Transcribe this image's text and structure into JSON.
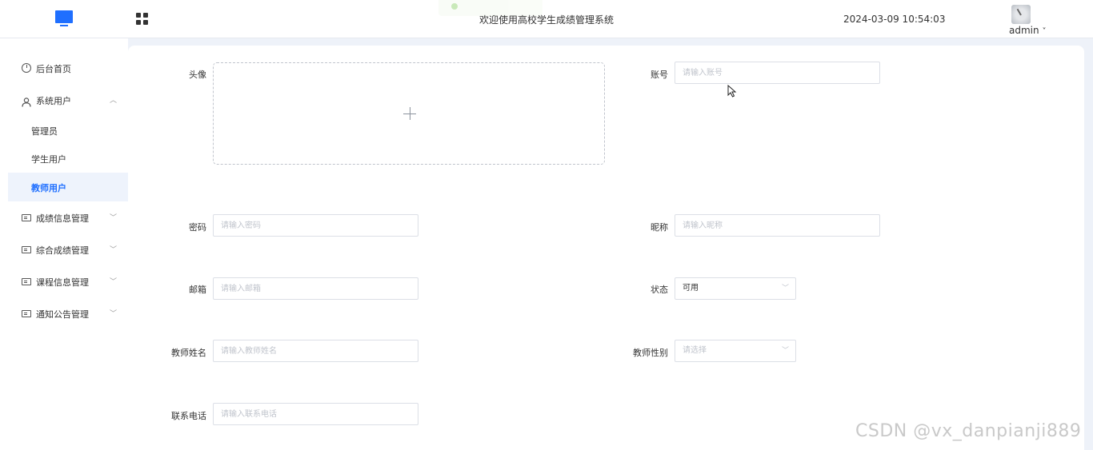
{
  "header": {
    "title": "欢迎使用高校学生成绩管理系统",
    "datetime": "2024-03-09 10:54:03",
    "user": "admin",
    "user_caret": "˅"
  },
  "sidebar": {
    "items": [
      {
        "label": "后台首页",
        "icon": "clock-icon"
      },
      {
        "label": "系统用户",
        "icon": "user-icon",
        "expanded": true
      },
      {
        "label": "成绩信息管理",
        "icon": "card-icon"
      },
      {
        "label": "综合成绩管理",
        "icon": "card-icon"
      },
      {
        "label": "课程信息管理",
        "icon": "card-icon"
      },
      {
        "label": "通知公告管理",
        "icon": "card-icon"
      }
    ],
    "sub_items": [
      {
        "label": "管理员"
      },
      {
        "label": "学生用户"
      },
      {
        "label": "教师用户",
        "active": true
      }
    ],
    "arrow_up": "︿",
    "arrow_down": "﹀"
  },
  "form": {
    "avatar_label": "头像",
    "account_label": "账号",
    "account_placeholder": "请输入账号",
    "password_label": "密码",
    "password_placeholder": "请输入密码",
    "nickname_label": "昵称",
    "nickname_placeholder": "请输入昵称",
    "email_label": "邮箱",
    "email_placeholder": "请输入邮箱",
    "status_label": "状态",
    "status_value": "可用",
    "teacher_name_label": "教师姓名",
    "teacher_name_placeholder": "请输入教师姓名",
    "teacher_gender_label": "教师性别",
    "teacher_gender_placeholder": "请选择",
    "phone_label": "联系电话",
    "phone_placeholder": "请输入联系电话",
    "select_arrow": "﹀"
  },
  "watermark": "CSDN @vx_danpianji889",
  "colors": {
    "accent": "#1f6fff",
    "background": "#eef2f9",
    "active_bg": "#eef3fc"
  }
}
